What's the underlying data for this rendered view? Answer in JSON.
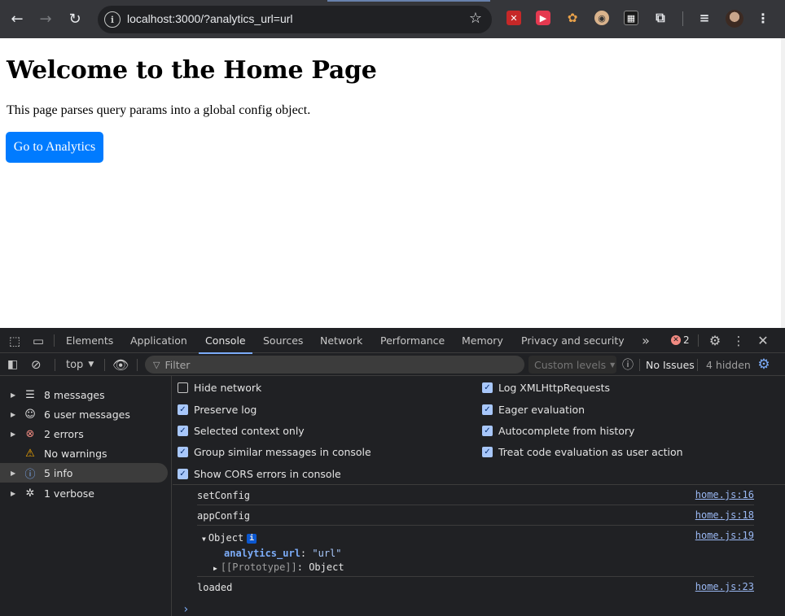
{
  "browser": {
    "url": "localhost:3000/?analytics_url=url",
    "back_icon": "arrow-left-icon",
    "forward_icon": "arrow-right-icon",
    "reload_icon": "reload-icon",
    "bookmark_icon": "star-icon"
  },
  "page": {
    "heading": "Welcome to the Home Page",
    "description": "This page parses query params into a global config object.",
    "button_label": "Go to Analytics",
    "button_color": "#007bff"
  },
  "devtools": {
    "tabs": [
      "Elements",
      "Application",
      "Console",
      "Sources",
      "Network",
      "Performance",
      "Memory",
      "Privacy and security"
    ],
    "active_tab": "Console",
    "more_tabs": "»",
    "error_count": "2",
    "toolbar": {
      "context": "top",
      "filter_placeholder": "Filter",
      "levels": "Custom levels",
      "issues": "No Issues",
      "hidden": "4 hidden"
    },
    "sidebar": [
      {
        "label": "8 messages",
        "icon": "list-icon"
      },
      {
        "label": "6 user messages",
        "icon": "user-icon"
      },
      {
        "label": "2 errors",
        "icon": "error-icon"
      },
      {
        "label": "No warnings",
        "icon": "warning-icon"
      },
      {
        "label": "5 info",
        "icon": "info-icon"
      },
      {
        "label": "1 verbose",
        "icon": "bug-icon"
      }
    ],
    "settings_left": [
      {
        "label": "Hide network",
        "checked": false
      },
      {
        "label": "Preserve log",
        "checked": true
      },
      {
        "label": "Selected context only",
        "checked": true
      },
      {
        "label": "Group similar messages in console",
        "checked": true
      },
      {
        "label": "Show CORS errors in console",
        "checked": true
      }
    ],
    "settings_right": [
      {
        "label": "Log XMLHttpRequests",
        "checked": true
      },
      {
        "label": "Eager evaluation",
        "checked": true
      },
      {
        "label": "Autocomplete from history",
        "checked": true
      },
      {
        "label": "Treat code evaluation as user action",
        "checked": true
      }
    ],
    "messages": [
      {
        "text": "setConfig",
        "source": "home.js:16"
      },
      {
        "text": "appConfig",
        "source": "home.js:18"
      },
      {
        "text": "Object",
        "source": "home.js:19"
      },
      {
        "text": "loaded",
        "source": "home.js:23"
      }
    ],
    "object": {
      "key": "analytics_url",
      "value": "\"url\"",
      "proto_key": "[[Prototype]]",
      "proto_value": "Object",
      "info_badge": "i"
    },
    "prompt": "›"
  }
}
